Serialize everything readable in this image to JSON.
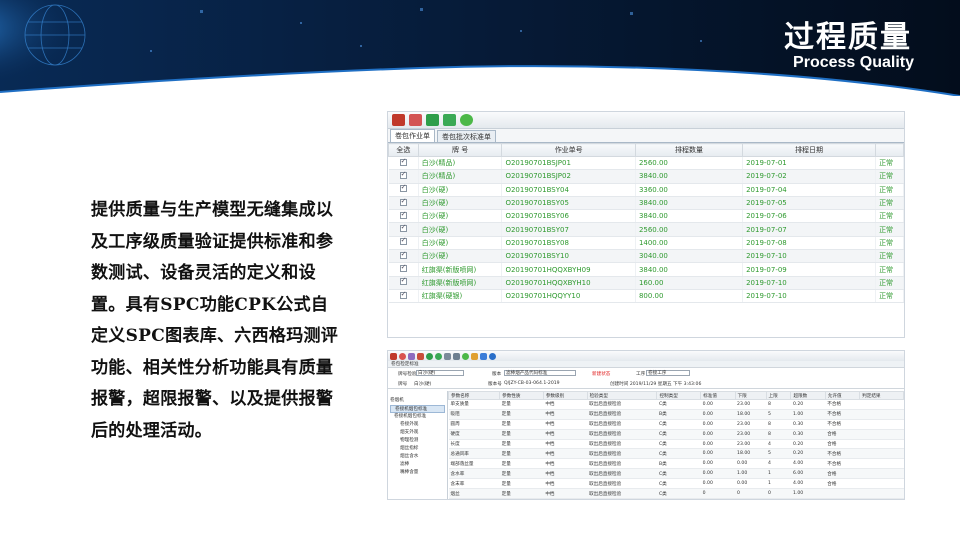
{
  "header": {
    "title_cn": "过程质量",
    "title_en": "Process Quality"
  },
  "description": "提供质量与生产模型无缝集成以及工序级质量验证提供标准和参数测试、设备灵活的定义和设置。具有SPC功能CPK公式自定义SPC图表库、六西格玛测评功能、相关性分析功能具有质量报警，超限报警、以及提供报警后的处理活动。",
  "colors": {
    "accent_green": "#2f9a2f",
    "banner_dark": "#061a33",
    "banner_blue": "#0d3d78"
  },
  "screenshot1": {
    "toolbar_icons": [
      "print-icon",
      "print-preview-icon",
      "refresh-icon",
      "refresh-alt-icon",
      "go-icon"
    ],
    "tabs": [
      "卷包作业单",
      "卷包批次标准单"
    ],
    "columns": [
      "全选",
      "牌 号",
      "作业单号",
      "排程数量",
      "排程日期",
      ""
    ],
    "rows": [
      [
        "白沙(精品)",
        "O20190701BSJP01",
        "2560.00",
        "2019-07-01",
        "正常"
      ],
      [
        "白沙(精品)",
        "O20190701BSJP02",
        "3840.00",
        "2019-07-02",
        "正常"
      ],
      [
        "白沙(硬)",
        "O20190701BSY04",
        "3360.00",
        "2019-07-04",
        "正常"
      ],
      [
        "白沙(硬)",
        "O20190701BSY05",
        "3840.00",
        "2019-07-05",
        "正常"
      ],
      [
        "白沙(硬)",
        "O20190701BSY06",
        "3840.00",
        "2019-07-06",
        "正常"
      ],
      [
        "白沙(硬)",
        "O20190701BSY07",
        "2560.00",
        "2019-07-07",
        "正常"
      ],
      [
        "白沙(硬)",
        "O20190701BSY08",
        "1400.00",
        "2019-07-08",
        "正常"
      ],
      [
        "白沙(硬)",
        "O20190701BSY10",
        "3040.00",
        "2019-07-10",
        "正常"
      ],
      [
        "红旗渠(新版喷网)",
        "O20190701HQQXBYH09",
        "3840.00",
        "2019-07-09",
        "正常"
      ],
      [
        "红旗渠(新版喷网)",
        "O20190701HQQXBYH10",
        "160.00",
        "2019-07-10",
        "正常"
      ],
      [
        "红旗渠(硬银)",
        "O20190701HQQYY10",
        "800.00",
        "2019-07-10",
        "正常"
      ]
    ]
  },
  "screenshot2": {
    "window_title": "卷包检定标准",
    "form": {
      "label_brand": "牌号检验",
      "value_brand": "白沙(硬)",
      "label_version": "版本",
      "value_version": "滤棒烟产品代码标准",
      "status": "新建状态",
      "label_process": "工序",
      "value_process": "卷接工序",
      "label_code": "牌号",
      "value_code": "白沙(硬)",
      "label_doc": "版本号",
      "value_doc": "Q/JZY-CB-03-064.1-2019",
      "created": "创建时间 2019/11/29 星期五 下午 3:43:06"
    },
    "tree": [
      "卷烟机",
      "卷接机烟包标准",
      "卷接机烟包标准",
      "卷接外观",
      "烟支外观",
      "物理检测",
      "烟丝指标",
      "烟丝含水",
      "滤棒",
      "嘴棒含量"
    ],
    "columns": [
      "参数名称",
      "参数性质",
      "参数级别",
      "检验类型",
      "控制类型",
      "标准值",
      "下限",
      "上限",
      "超限数",
      "允许值",
      "判定结果"
    ],
    "rows": [
      [
        "单支质量",
        "定量",
        "中档",
        "取出后直接检验",
        "C类",
        "0.00",
        "23.00",
        "8",
        "0.20",
        "不合格"
      ],
      [
        "吸阻",
        "定量",
        "中档",
        "取出后直接检验",
        "B类",
        "0.00",
        "18.00",
        "5",
        "1.00",
        "不合格"
      ],
      [
        "圆周",
        "定量",
        "中档",
        "取出后直接检验",
        "C类",
        "0.00",
        "23.00",
        "8",
        "0.30",
        "不合格"
      ],
      [
        "硬度",
        "定量",
        "中档",
        "取出后直接检验",
        "C类",
        "0.00",
        "23.00",
        "8",
        "0.30",
        "合格"
      ],
      [
        "长度",
        "定量",
        "中档",
        "取出后直接检验",
        "C类",
        "0.00",
        "23.00",
        "4",
        "0.20",
        "合格"
      ],
      [
        "总通风率",
        "定量",
        "中档",
        "取出后直接检验",
        "C类",
        "0.00",
        "18.00",
        "5",
        "0.20",
        "不合格"
      ],
      [
        "端部落丝量",
        "定量",
        "中档",
        "取出后直接检验",
        "B类",
        "0.00",
        "0.00",
        "4",
        "4.00",
        "不合格"
      ],
      [
        "含水率",
        "定量",
        "中档",
        "取出后直接检验",
        "C类",
        "0.00",
        "1.00",
        "1",
        "6.00",
        "合格"
      ],
      [
        "含末率",
        "定量",
        "中档",
        "取出后直接检验",
        "C类",
        "0.00",
        "0.00",
        "1",
        "4.00",
        "合格"
      ],
      [
        "烟丝",
        "定量",
        "中档",
        "取出后直接检验",
        "C类",
        "0",
        "0",
        "0",
        "1.00",
        ""
      ]
    ]
  }
}
